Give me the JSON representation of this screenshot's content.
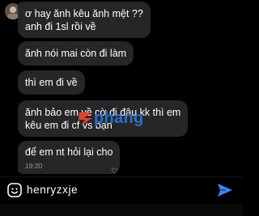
{
  "messages": [
    {
      "lines": [
        "ơ hay ănh kêu ănh mệt ??",
        "anh đi 1sl rồi về"
      ]
    },
    {
      "lines": [
        "ănh nói mai còn đi làm"
      ]
    },
    {
      "lines": [
        "thì em đi về"
      ]
    },
    {
      "lines": [
        "ănh bảo em về cờ đi đâu kk thì em",
        "kêu em đi cf vs bạn"
      ]
    },
    {
      "lines": [
        "để em nt hỏi lại cho"
      ],
      "time": "19:20"
    }
  ],
  "reaction": "♡",
  "watermark": {
    "text": "phang",
    "brand_color": "#e8402f",
    "text_color": "#2b6fc8"
  },
  "composer": {
    "input_value": "henryzxje",
    "send_color": "#3b82f6",
    "icons": [
      "emoji-icon",
      "send-icon"
    ]
  },
  "keyboard": {
    "suggestions": [
      "",
      "",
      ""
    ]
  }
}
